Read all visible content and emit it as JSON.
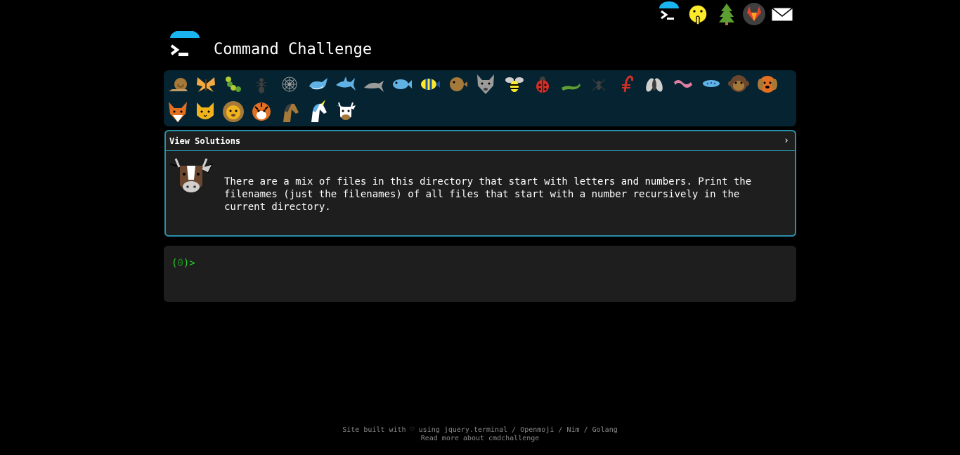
{
  "header": {
    "title": "Command Challenge",
    "logo_icon": "terminal-prompt-logo-icon"
  },
  "top_nav": {
    "icons": [
      "terminal-logo-icon",
      "shushing-face-icon",
      "tree-icon",
      "gitlab-icon",
      "envelope-icon"
    ]
  },
  "challenges": {
    "icons": [
      "snail-icon",
      "butterfly-icon",
      "caterpillar-icon",
      "ant-icon",
      "web-icon",
      "whale-icon",
      "shark-icon",
      "dolphin-icon",
      "fish-icon",
      "tropical-fish-icon",
      "blowfish-icon",
      "wolf-icon",
      "bee-icon",
      "ladybug-icon",
      "lizard-icon",
      "spider-icon",
      "scorpion-icon",
      "fly-icon",
      "worm-icon",
      "microbe-icon",
      "monkey-icon",
      "dog-icon",
      "fox-icon",
      "cat-icon",
      "lion-icon",
      "tiger-icon",
      "horse-icon",
      "unicorn-icon",
      "cow-icon"
    ],
    "current": "cow-icon"
  },
  "solutions_panel": {
    "label": "View Solutions",
    "chevron": "›",
    "challenge_icon": "cow-icon",
    "description": "There are a mix of files in this directory that start with letters and numbers. Print the filenames (just the filenames) of all files that start with a number recursively in the current directory."
  },
  "terminal": {
    "prompt_open": "(",
    "prompt_num": "0",
    "prompt_close": ")>"
  },
  "footer": {
    "line1_prefix": "Site built with",
    "heart": "♡",
    "using": "using",
    "link_jquery": "jquery.terminal",
    "sep1": "/",
    "link_openmoji": "Openmoji",
    "sep2": "/",
    "link_nim": "Nim",
    "sep3": "/",
    "link_golang": "Golang",
    "line2": "Read more about cmdchallenge"
  },
  "colors": {
    "background": "#000000",
    "challenge_bar": "#052330",
    "panel_border": "#2a8fa8",
    "terminal_bg": "#1e1e1e",
    "prompt_green": "#2bd42b",
    "accent_blue": "#1ab4f0"
  }
}
